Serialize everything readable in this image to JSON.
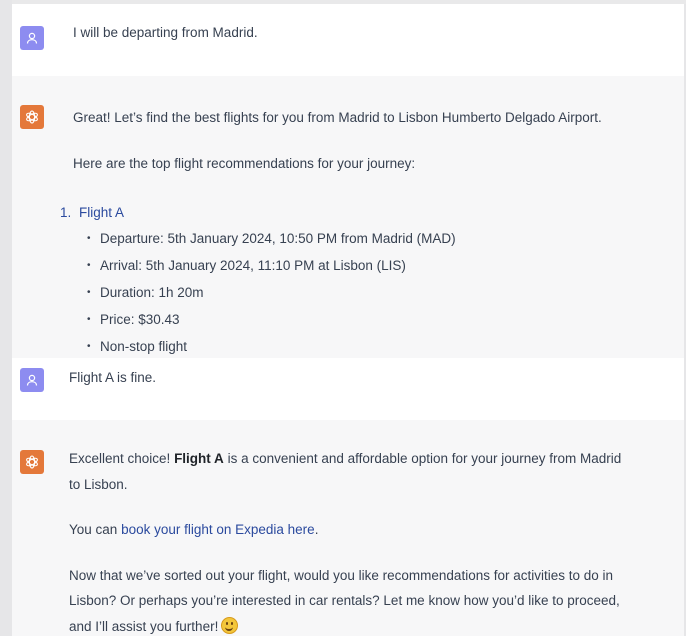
{
  "conversation": {
    "msg1": {
      "text": "I will be departing from Madrid."
    },
    "msg2": {
      "intro": "Great! Let’s find the best flights for you from Madrid to Lisbon Humberto Delgado Airport.",
      "lead": "Here are the top flight recommendations for your journey:",
      "list_number": "1.",
      "flight_name": "Flight A",
      "details": [
        "Departure: 5th January 2024, 10:50 PM from Madrid (MAD)",
        "Arrival: 5th January 2024, 11:10 PM at Lisbon (LIS)",
        "Duration: 1h 20m",
        "Price: $30.43",
        "Non-stop flight"
      ]
    },
    "msg3": {
      "text": "Flight A is fine."
    },
    "msg4": {
      "line1_pre": "Excellent choice! ",
      "line1_bold": "Flight A",
      "line1_post": " is a convenient and affordable option for your journey from Madrid",
      "line2": "to Lisbon.",
      "book_pre": "You can ",
      "book_link": "book your flight on Expedia here",
      "book_post": ".",
      "para_line1": "Now that we’ve sorted out your flight, would you like recommendations for activities to do in",
      "para_line2": "Lisbon? Or perhaps you’re interested in car rentals? Let me know how you’d like to proceed,",
      "para_line3": "and I’ll assist you further!"
    }
  },
  "icons": {
    "user_avatar": "user-icon",
    "assistant_avatar": "openai-logo-icon",
    "emoji": "smiling-face-icon"
  },
  "colors": {
    "user_avatar_bg": "#8d8cf0",
    "assistant_avatar_bg": "#e4783a",
    "link": "#2b4a9e",
    "bot_row_bg": "#f7f7f8",
    "user_row_bg": "#ffffff"
  }
}
